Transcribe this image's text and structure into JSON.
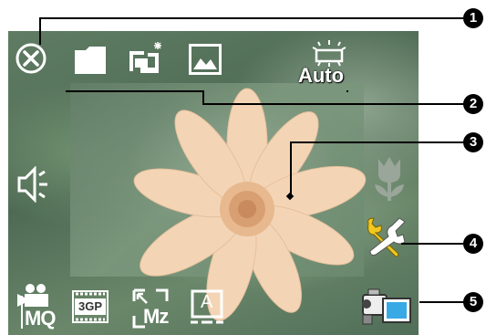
{
  "top_toolbar": {
    "close_icon": "close-circle-icon",
    "folder_icon": "folder-icon",
    "capture_mode_icon": "flash-camera-icon",
    "image_icon": "image-gallery-icon",
    "white_balance_icon": "white-balance-icon",
    "white_balance_label": "Auto"
  },
  "preview": {
    "subject": "flower-preview"
  },
  "side_controls": {
    "volume_icon": "speaker-icon",
    "macro_icon": "macro-tulip-icon",
    "settings_icon": "wrench-settings-icon"
  },
  "bottom_toolbar": {
    "video_quality_icon": "video-camera-mq-icon",
    "video_quality_label": "MQ",
    "format_label": "3GP",
    "zoom_label": "Mz",
    "text_label": "A",
    "mode_switch_icon": "camcorder-icon"
  },
  "callouts": {
    "items": [
      {
        "label": "1"
      },
      {
        "label": "2"
      },
      {
        "label": "3"
      },
      {
        "label": "4"
      },
      {
        "label": "5"
      }
    ]
  },
  "colors": {
    "badge": "#000000",
    "icon": "#ffffff",
    "screen_green": "#5f7c63"
  }
}
